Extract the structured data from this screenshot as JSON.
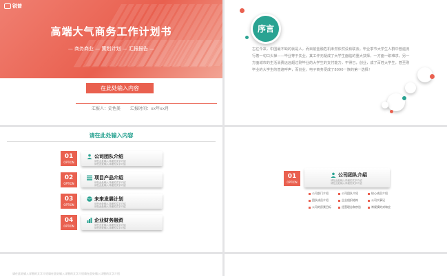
{
  "slide1": {
    "logo": "锐普",
    "title": "高端大气商务工作计划书",
    "subtitle": "— 商务商业 — 策划计划 — 汇报报告 —",
    "input_button": "在此处输入内容",
    "reporter": "汇报人：史色美",
    "date": "汇报时间：xx年xx月"
  },
  "slide2": {
    "heading": "序言",
    "body": "古往今来，中国最不缺的就是人，而目前金融危机未然依然没有联去。毕业季节大学生人群中普遍流行着一句口头禅——毕业等于失业。其工作无疑成了大学生面临的重大抉择，一方面一职难求，另一方面城市的生活消费远远超过刚毕业的大学生的支付能力，不得已，创业，成了百姓大学生，甚至刚毕业的大学生的普遍呼声，而创业，电子商务便成了8090一族的第一选择！"
  },
  "slide3": {
    "title": "请在此处输入内容",
    "items": [
      {
        "num": "01",
        "opt": "OPTION",
        "label": "公司团队介绍",
        "desc": "请在此处输入详细的文字介绍\n请在此处输入详细的文字介绍"
      },
      {
        "num": "02",
        "opt": "OPTION",
        "label": "项目产品介绍",
        "desc": "请在此处输入详细的文字介绍\n请在此处输入详细的文字介绍"
      },
      {
        "num": "03",
        "opt": "OPTION",
        "label": "未来发展计划",
        "desc": "请在此处输入详细的文字介绍\n请在此处输入详细的文字介绍"
      },
      {
        "num": "04",
        "opt": "OPTION",
        "label": "企业财务融资",
        "desc": "请在此处输入详细的文字介绍\n请在此处输入详细的文字介绍"
      }
    ]
  },
  "slide4": {
    "num": "01",
    "opt": "OPTION",
    "label": "公司团队介绍",
    "desc": "请在此处输入详细的文字介绍\n请在此处输入详细的文字介绍",
    "tiles": [
      "公司部门介绍",
      "公司团队介绍",
      "核心成员介绍",
      "团队成员介绍",
      "企业组织结构",
      "公司大事记",
      "公司的愿景目标",
      "经营理念和宗旨",
      "常规模的对和应"
    ]
  },
  "slide5": {
    "text": "请在此处输入详细的文字介绍请在此处输入详细的文字介绍请在此处输入详细的文字介绍"
  },
  "colors": {
    "accent": "#e9604f",
    "teal": "#2aa392"
  }
}
